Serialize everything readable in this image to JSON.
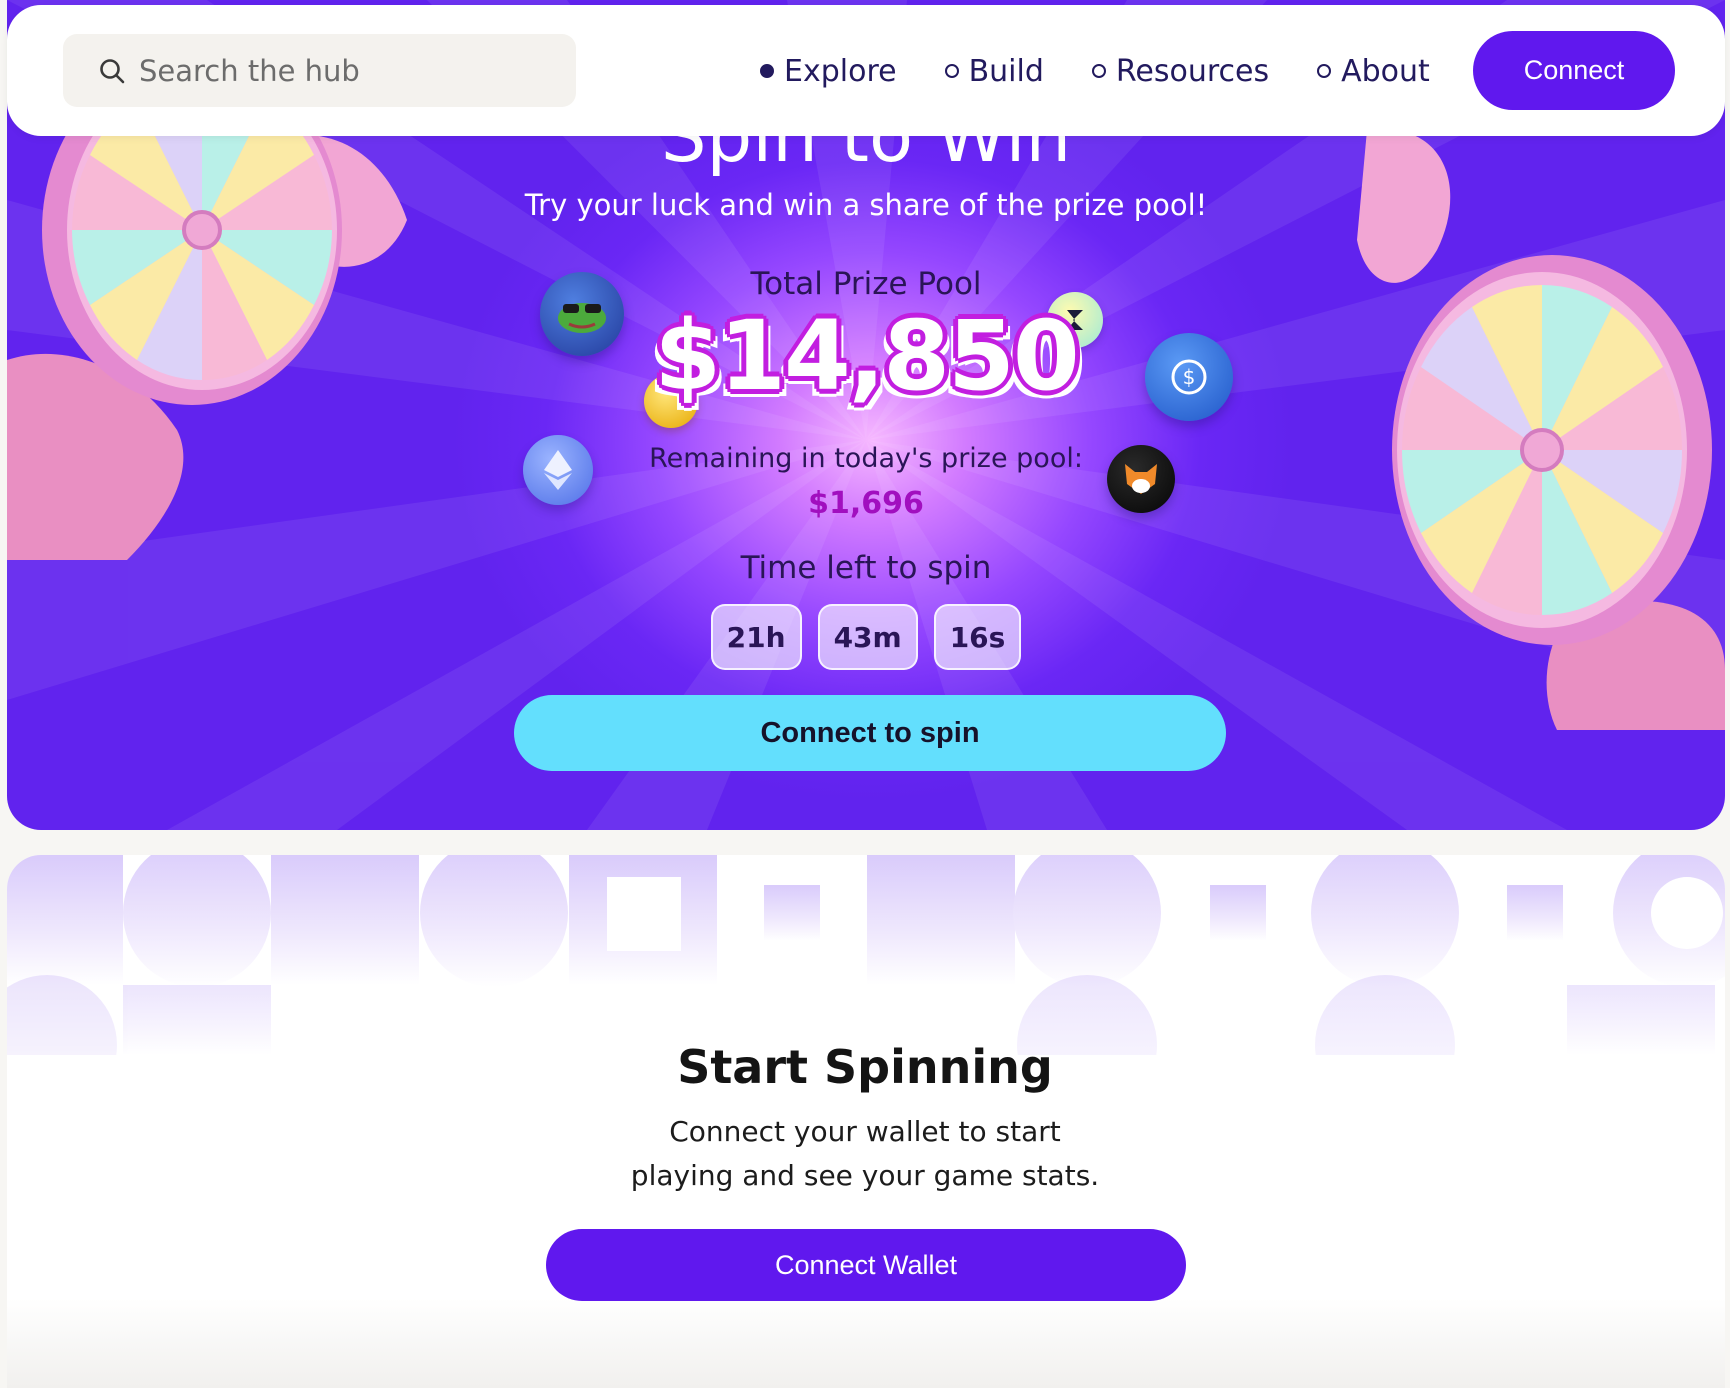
{
  "nav": {
    "search_placeholder": "Search the hub",
    "links": [
      {
        "label": "Explore",
        "active": true
      },
      {
        "label": "Build",
        "active": false
      },
      {
        "label": "Resources",
        "active": false
      },
      {
        "label": "About",
        "active": false
      }
    ],
    "connect_label": "Connect"
  },
  "hero": {
    "title": "Spin to Win",
    "subtitle": "Try your luck and win a share of the prize pool!",
    "pool_label": "Total Prize Pool",
    "pool_amount": "$14,850",
    "remaining_label": "Remaining in today's prize pool:",
    "remaining_amount": "$1,696",
    "time_label": "Time left to spin",
    "timer": {
      "hours": "21h",
      "minutes": "43m",
      "seconds": "16s"
    },
    "spin_button_label": "Connect to spin",
    "coins": [
      "pepe-coin-icon",
      "ethereum-coin-icon",
      "gold-coin-icon",
      "token-coin-icon",
      "usdc-coin-icon",
      "fox-coin-icon"
    ]
  },
  "start": {
    "title": "Start Spinning",
    "desc_line1": "Connect your wallet to start",
    "desc_line2": "playing and see your game stats.",
    "button_label": "Connect Wallet"
  },
  "colors": {
    "accent": "#6018ee",
    "hero_purple": "#6a27f5",
    "spin_button": "#63dffd",
    "prize_magenta": "#c21ee0",
    "nav_text": "#221a5e"
  }
}
